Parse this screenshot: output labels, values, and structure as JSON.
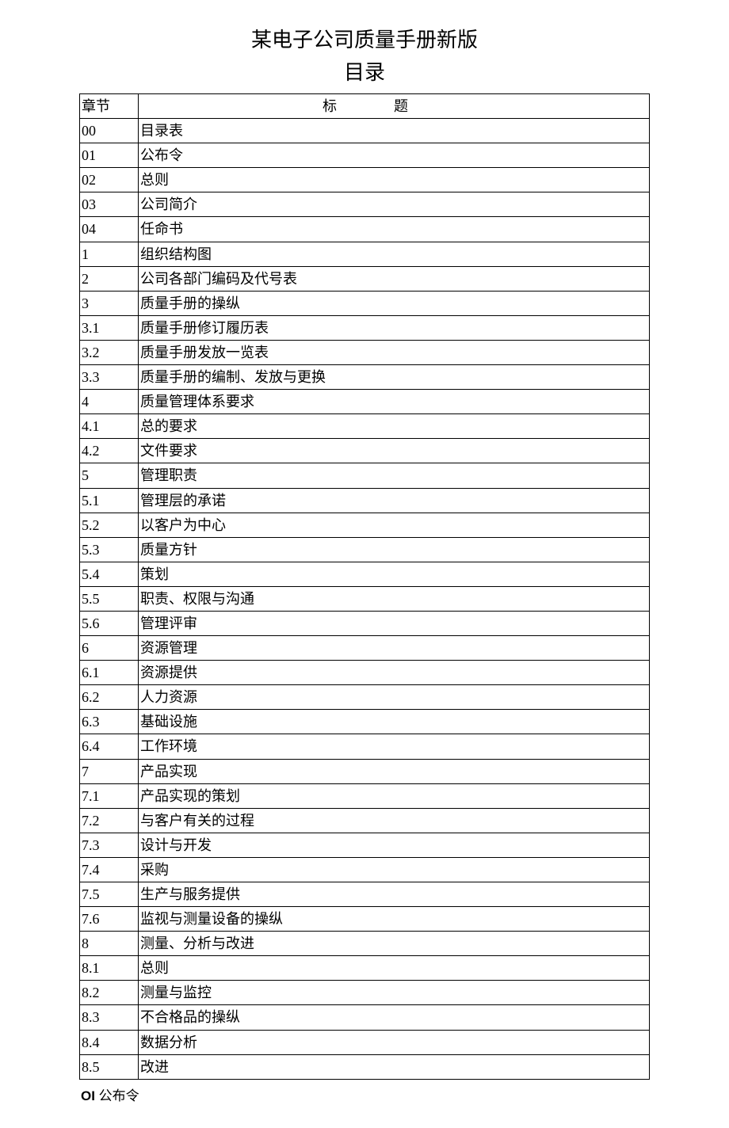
{
  "title_main": "某电子公司质量手册新版",
  "title_sub": "目录",
  "header": {
    "chapter": "章节",
    "title": "标题"
  },
  "rows": [
    {
      "chapter": "00",
      "title": "目录表"
    },
    {
      "chapter": "01",
      "title": "公布令"
    },
    {
      "chapter": "02",
      "title": "总则"
    },
    {
      "chapter": "03",
      "title": "公司简介"
    },
    {
      "chapter": "04",
      "title": "任命书"
    },
    {
      "chapter": "1",
      "title": "组织结构图"
    },
    {
      "chapter": "2",
      "title": "公司各部门编码及代号表"
    },
    {
      "chapter": "3",
      "title": "质量手册的操纵"
    },
    {
      "chapter": "3.1",
      "title": "质量手册修订履历表"
    },
    {
      "chapter": "3.2",
      "title": "质量手册发放一览表"
    },
    {
      "chapter": "3.3",
      "title": "质量手册的编制、发放与更换"
    },
    {
      "chapter": "4",
      "title": "质量管理体系要求"
    },
    {
      "chapter": "4.1",
      "title": "总的要求"
    },
    {
      "chapter": "4.2",
      "title": "文件要求"
    },
    {
      "chapter": "5",
      "title": "管理职责"
    },
    {
      "chapter": "5.1",
      "title": "管理层的承诺"
    },
    {
      "chapter": "5.2",
      "title": "以客户为中心"
    },
    {
      "chapter": "5.3",
      "title": "质量方针"
    },
    {
      "chapter": "5.4",
      "title": "策划"
    },
    {
      "chapter": "5.5",
      "title": "职责、权限与沟通"
    },
    {
      "chapter": "5.6",
      "title": "管理评审"
    },
    {
      "chapter": "6",
      "title": "资源管理"
    },
    {
      "chapter": "6.1",
      "title": "资源提供"
    },
    {
      "chapter": "6.2",
      "title": "人力资源"
    },
    {
      "chapter": "6.3",
      "title": "基础设施"
    },
    {
      "chapter": "6.4",
      "title": "工作环境"
    },
    {
      "chapter": "7",
      "title": "产品实现"
    },
    {
      "chapter": "7.1",
      "title": "产品实现的策划"
    },
    {
      "chapter": "7.2",
      "title": "与客户有关的过程"
    },
    {
      "chapter": "7.3",
      "title": "设计与开发"
    },
    {
      "chapter": "7.4",
      "title": "采购"
    },
    {
      "chapter": "7.5",
      "title": "生产与服务提供"
    },
    {
      "chapter": "7.6",
      "title": "监视与测量设备的操纵"
    },
    {
      "chapter": "8",
      "title": "测量、分析与改进"
    },
    {
      "chapter": "8.1",
      "title": "总则"
    },
    {
      "chapter": "8.2",
      "title": "测量与监控"
    },
    {
      "chapter": "8.3",
      "title": "不合格品的操纵"
    },
    {
      "chapter": "8.4",
      "title": "数据分析"
    },
    {
      "chapter": "8.5",
      "title": "改进"
    }
  ],
  "footer": {
    "bold": "OI",
    "rest": " 公布令"
  }
}
